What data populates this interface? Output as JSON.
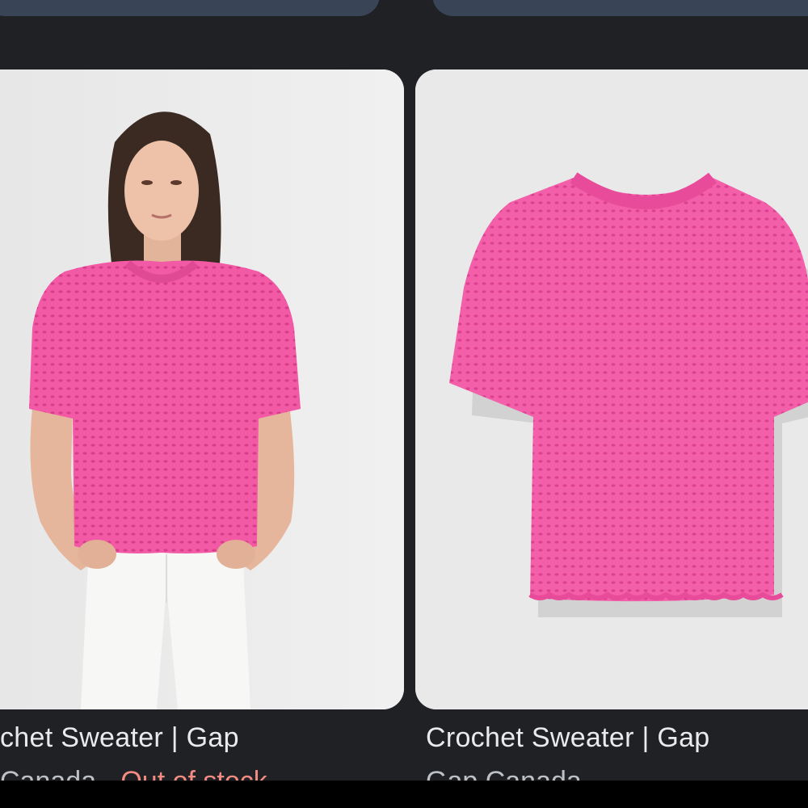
{
  "results": [
    {
      "title": "chet Sweater | Gap",
      "source": "Canada",
      "separator": "·",
      "status": "Out of stock",
      "image": "model-wearing-pink-crochet-sweater"
    },
    {
      "title": "Crochet Sweater | Gap",
      "source": "Gap Canada",
      "image": "pink-crochet-sweater-flat"
    }
  ],
  "colors": {
    "background": "#202124",
    "card": "#ebebeb",
    "chip": "#394457",
    "sweater": "#f25aa6",
    "out_of_stock": "#f28b82"
  }
}
